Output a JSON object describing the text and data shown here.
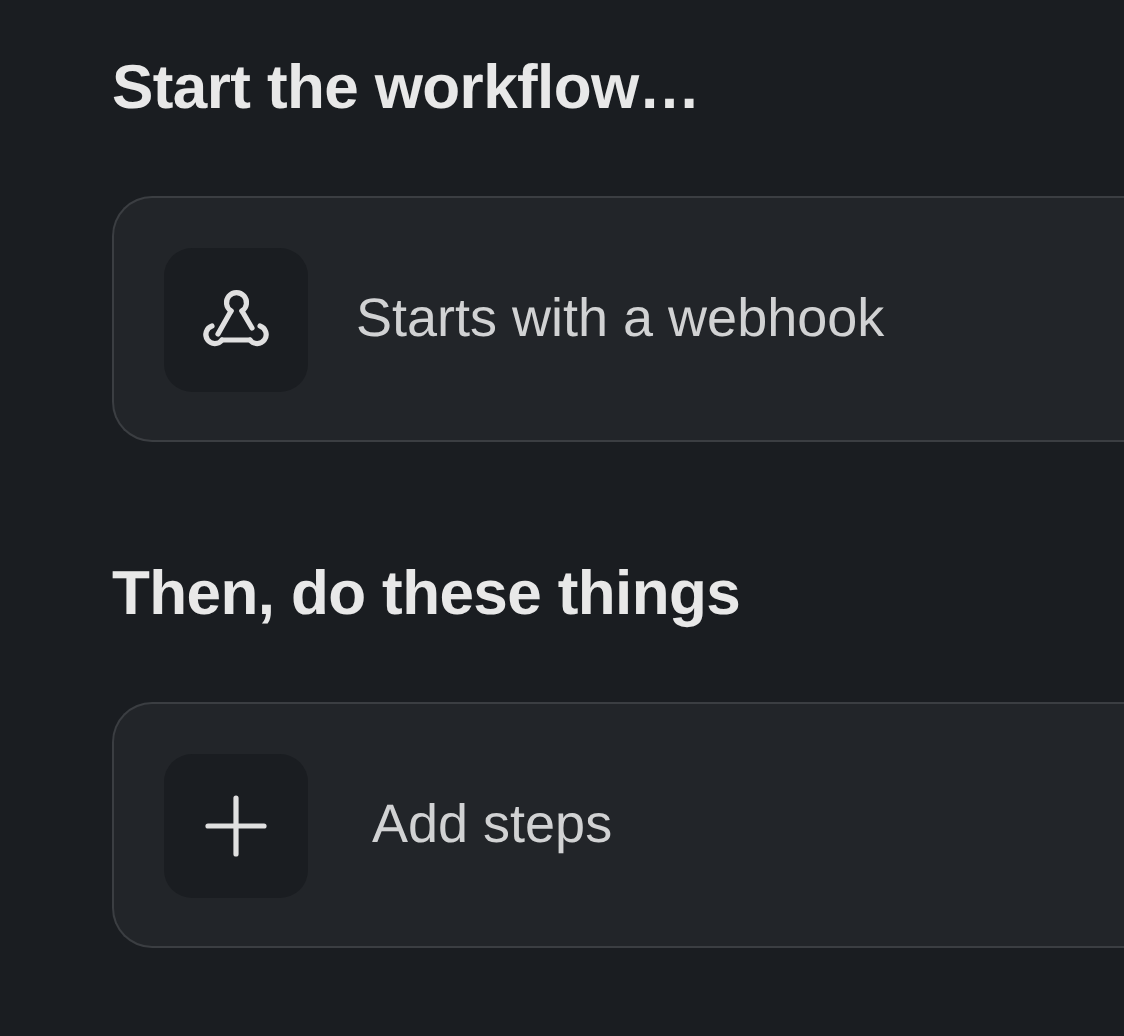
{
  "sections": [
    {
      "heading": "Start the workflow…",
      "card": {
        "kind": "webhook",
        "label": "Starts with a webhook"
      }
    },
    {
      "heading": "Then, do these things",
      "card": {
        "kind": "plus",
        "label": "Add steps"
      }
    }
  ]
}
